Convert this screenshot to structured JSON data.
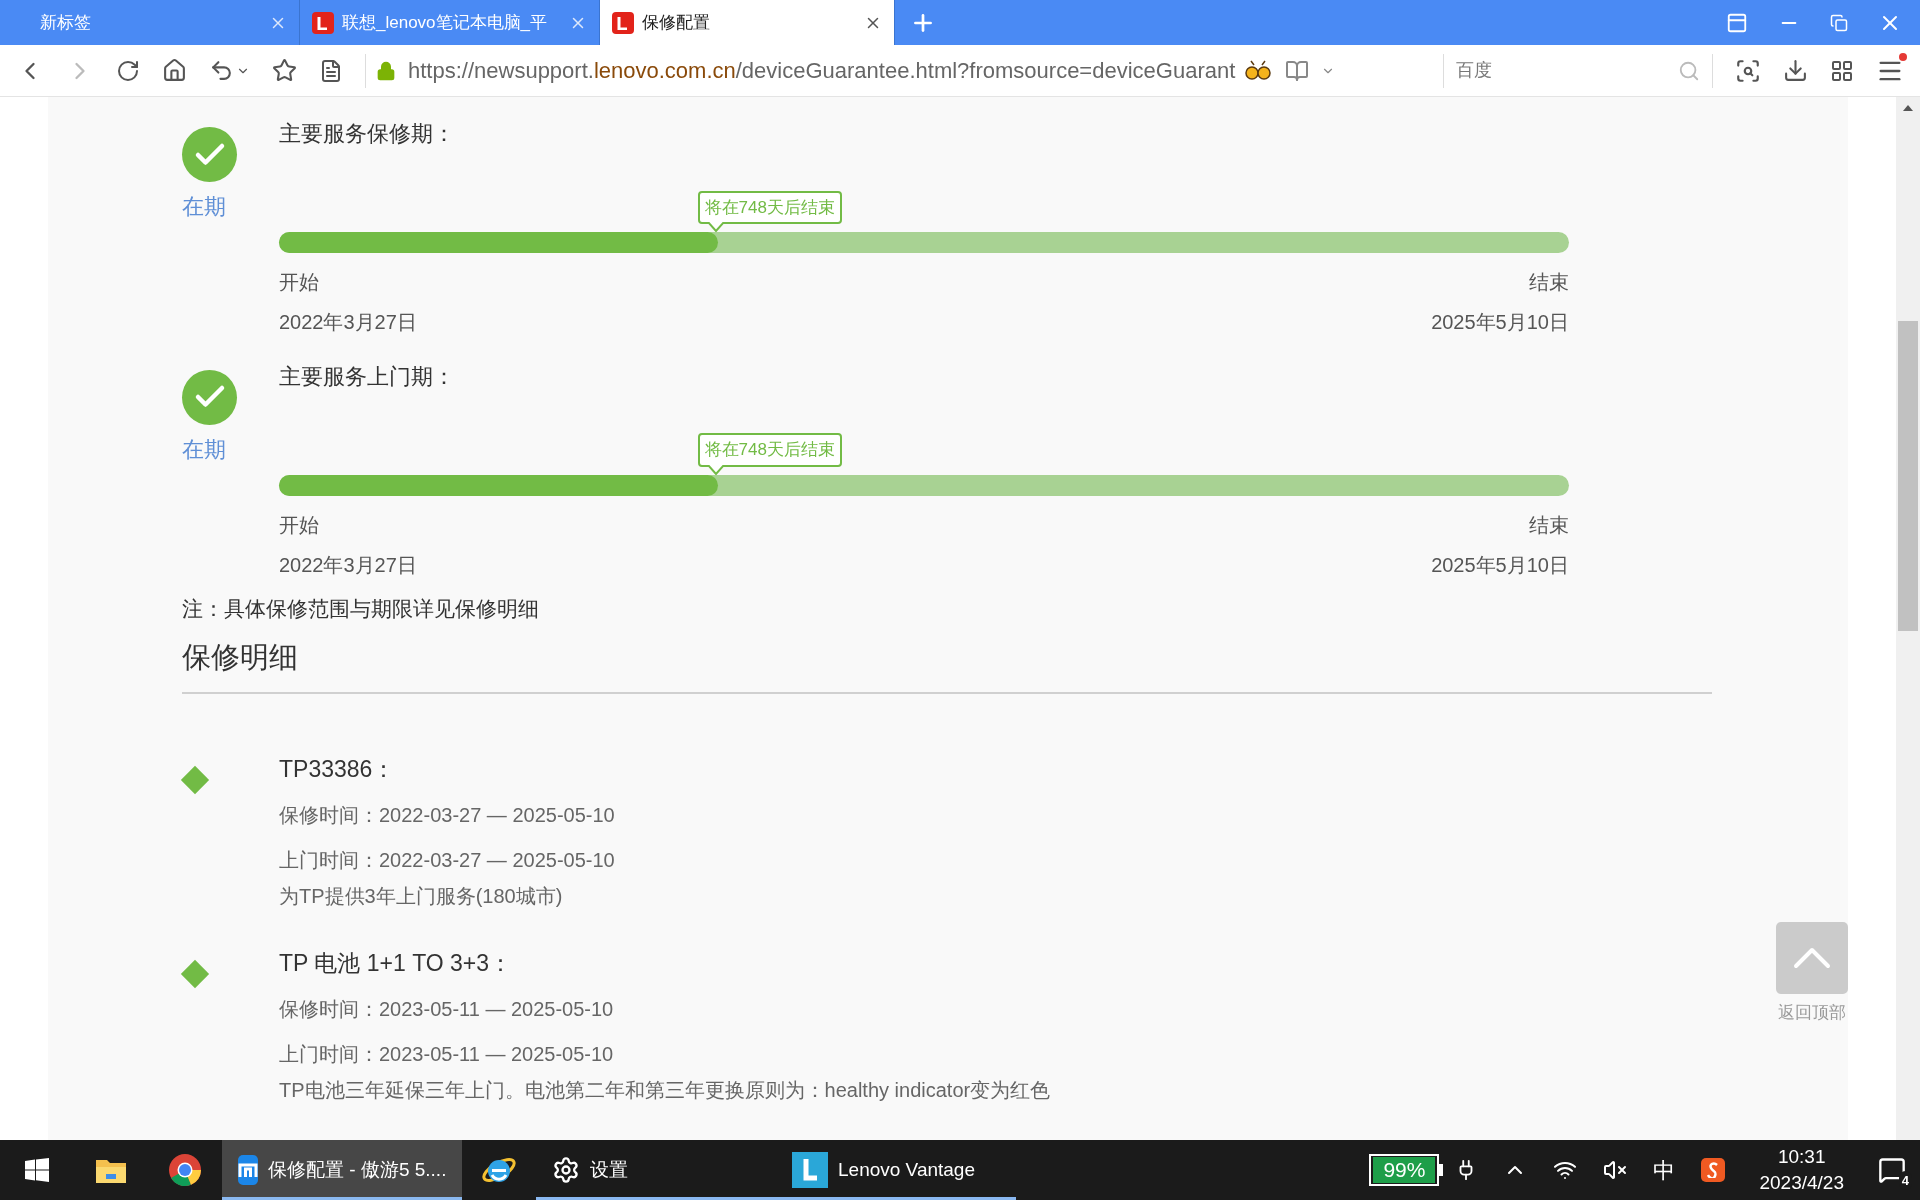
{
  "tabs": [
    {
      "title": "新标签",
      "favicon": false,
      "selected": false
    },
    {
      "title": "联想_lenovo笔记本电脑_平",
      "favicon": true,
      "selected": false
    },
    {
      "title": "保修配置",
      "favicon": true,
      "selected": true
    }
  ],
  "address_bar": {
    "prefix": "https://newsupport.",
    "domain": "lenovo.com.cn",
    "suffix": "/deviceGuarantee.html?fromsource=deviceGuarant"
  },
  "search": {
    "placeholder": "百度"
  },
  "warranty_periods": [
    {
      "status": "在期",
      "title": "主要服务保修期：",
      "bubble": "将在748天后结束",
      "level": 0.34,
      "start_label": "开始",
      "end_label": "结束",
      "start_date": "2022年3月27日",
      "end_date": "2025年5月10日"
    },
    {
      "status": "在期",
      "title": "主要服务上门期：",
      "bubble": "将在748天后结束",
      "level": 0.34,
      "start_label": "开始",
      "end_label": "结束",
      "start_date": "2022年3月27日",
      "end_date": "2025年5月10日"
    }
  ],
  "note": "注：具体保修范围与期限详见保修明细",
  "details_heading": "保修明细",
  "details": [
    {
      "title": "TP33386：",
      "warranty": "保修时间：2022-03-27 — 2025-05-10",
      "onsite": "上门时间：2022-03-27 — 2025-05-10",
      "description": "为TP提供3年上门服务(180城市)"
    },
    {
      "title": "TP 电池 1+1 TO 3+3：",
      "warranty": "保修时间：2023-05-11 — 2025-05-10",
      "onsite": "上门时间：2023-05-11 — 2025-05-10",
      "description": "TP电池三年延保三年上门。电池第二年和第三年更换原则为：healthy indicator变为红色"
    }
  ],
  "back_to_top": "返回顶部",
  "taskbar": [
    {
      "kind": "start",
      "running": false,
      "selected": false
    },
    {
      "kind": "explorer",
      "running": false,
      "selected": false
    },
    {
      "kind": "chrome",
      "running": false,
      "selected": false
    },
    {
      "kind": "maxthon",
      "label": "保修配置 - 傲游5 5....",
      "running": true,
      "selected": true
    },
    {
      "kind": "ie",
      "running": false,
      "selected": false
    },
    {
      "kind": "settings",
      "label": "设置",
      "running": true,
      "selected": false
    },
    {
      "kind": "vantage",
      "label": "Lenovo Vantage",
      "running": true,
      "selected": false
    }
  ],
  "tray": {
    "battery": "99%",
    "ime": "中",
    "time": "10:31",
    "date": "2023/4/23",
    "notifications": "4"
  }
}
